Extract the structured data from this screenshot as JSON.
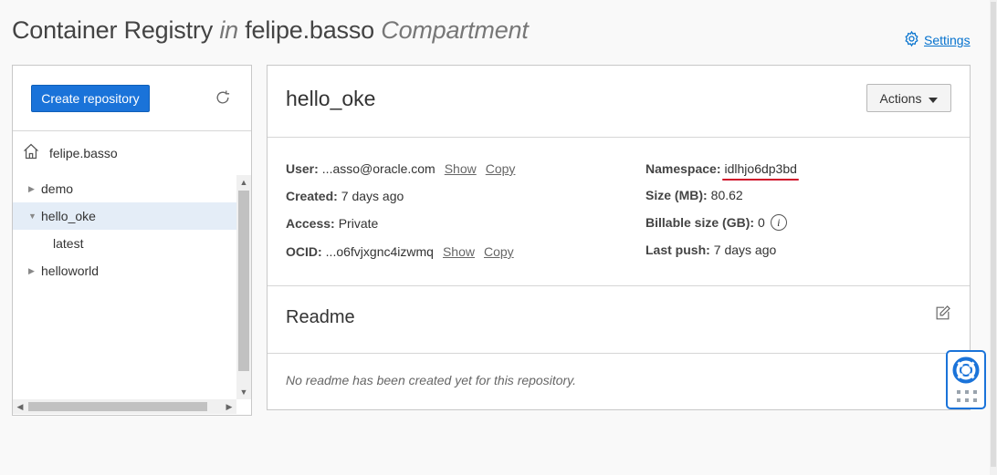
{
  "header": {
    "title_main": "Container Registry",
    "title_in": "in",
    "compartment_name": "felipe.basso",
    "title_compartment": "Compartment",
    "settings_label": "Settings",
    "settings_icon": "gear-icon"
  },
  "sidebar": {
    "create_button_label": "Create repository",
    "refresh_icon": "refresh-icon",
    "compartment_label": "felipe.basso",
    "tree": [
      {
        "label": "demo",
        "expanded": false
      },
      {
        "label": "hello_oke",
        "expanded": true,
        "selected": true
      },
      {
        "label": "latest",
        "child": true
      },
      {
        "label": "helloworld",
        "expanded": false
      }
    ]
  },
  "repository": {
    "name": "hello_oke",
    "actions_label": "Actions",
    "details": {
      "user_label": "User:",
      "user_value": "...asso@oracle.com",
      "created_label": "Created:",
      "created_value": "7 days ago",
      "access_label": "Access:",
      "access_value": "Private",
      "ocid_label": "OCID:",
      "ocid_value": "...o6fvjxgnc4izwmq",
      "show_label": "Show",
      "copy_label": "Copy",
      "namespace_label": "Namespace:",
      "namespace_value": "idlhjo6dp3bd",
      "size_label": "Size (MB):",
      "size_value": "80.62",
      "billable_label": "Billable size (GB):",
      "billable_value": "0",
      "last_push_label": "Last push:",
      "last_push_value": "7 days ago"
    },
    "readme": {
      "title": "Readme",
      "empty_text": "No readme has been created yet for this repository."
    }
  },
  "colors": {
    "primary_button": "#1a73d9",
    "link": "#0572ce",
    "highlight_underline": "#d0102a",
    "selected_row": "#e4edf7"
  }
}
